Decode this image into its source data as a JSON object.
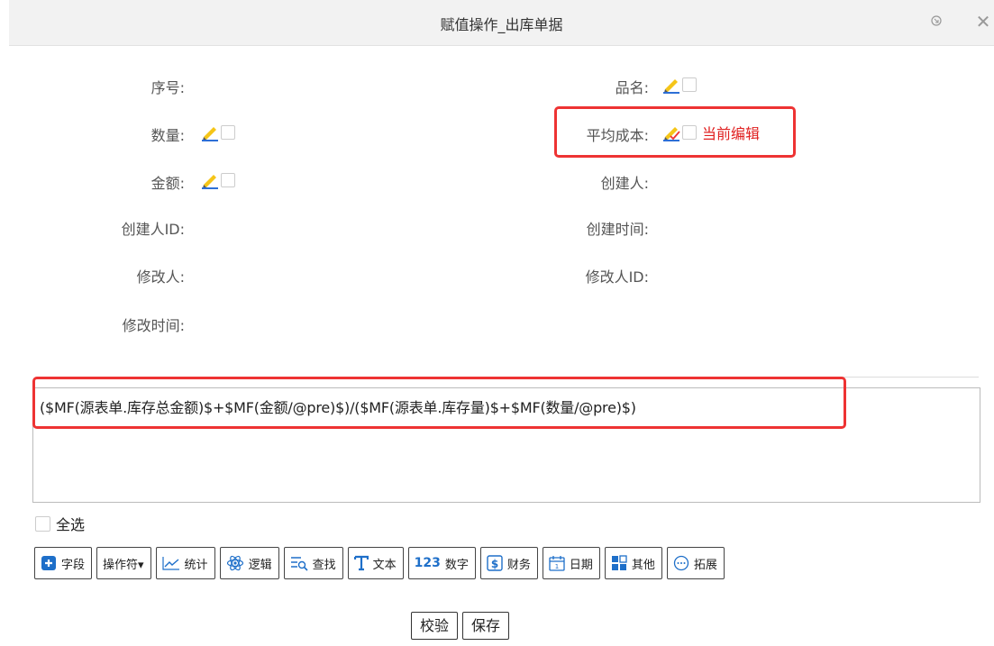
{
  "window": {
    "title": "赋值操作_出库单据"
  },
  "fields": {
    "serial": "序号:",
    "product_name": "品名:",
    "quantity": "数量:",
    "avg_cost": "平均成本:",
    "amount": "金额:",
    "creator": "创建人:",
    "creator_id": "创建人ID:",
    "created_time": "创建时间:",
    "modifier": "修改人:",
    "modifier_id": "修改人ID:",
    "modified_time": "修改时间:"
  },
  "current_edit_label": "当前编辑",
  "formula": "($MF(源表单.库存总金额)$+$MF(金额/@pre)$)/($MF(源表单.库存量)$+$MF(数量/@pre)$)",
  "select_all": "全选",
  "toolbar": {
    "field": "字段",
    "operator": "操作符▾",
    "stats": "统计",
    "logic": "逻辑",
    "lookup": "查找",
    "text": "文本",
    "number": "数字",
    "finance": "财务",
    "date": "日期",
    "other": "其他",
    "extend": "拓展"
  },
  "actions": {
    "validate": "校验",
    "save": "保存"
  },
  "colors": {
    "highlight": "#e33333",
    "accent_blue": "#1e6fc9"
  }
}
